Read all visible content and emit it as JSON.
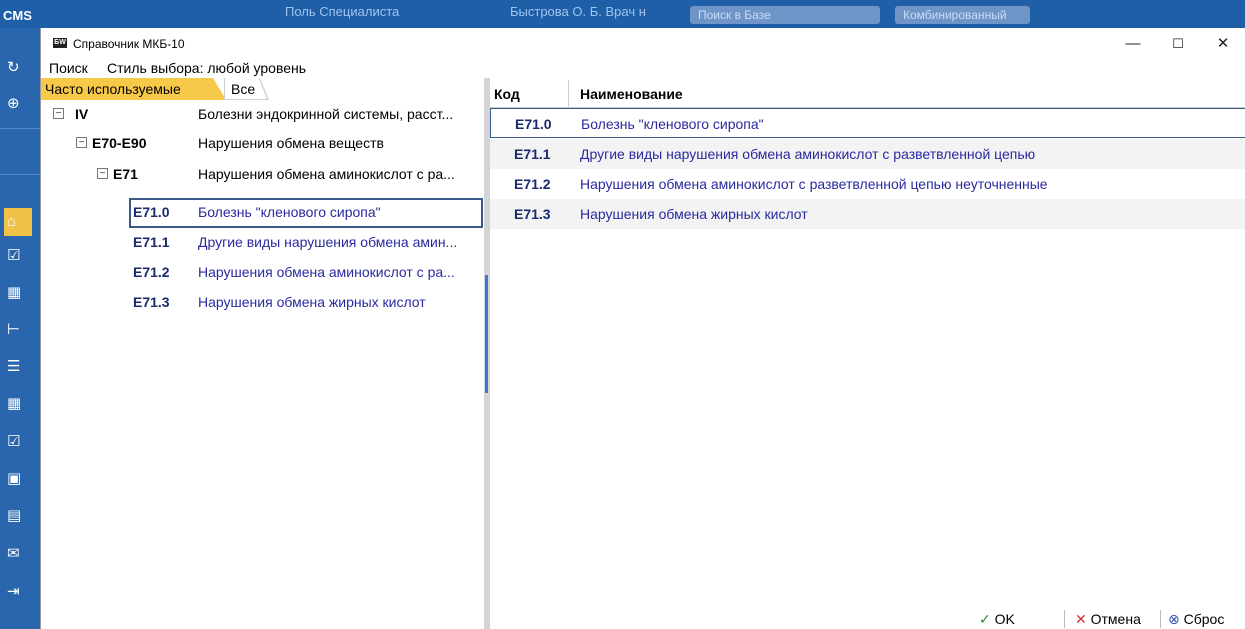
{
  "background_app": {
    "logo": "CMS",
    "top_items": [
      "Поль Специалиста",
      "Быстрова О. Б. Врач н",
      "Поиск в Базе",
      "Комбинированный"
    ]
  },
  "dialog": {
    "title": "Справочник МКБ-10",
    "app_icon_text": "БW",
    "window_controls": {
      "minimize": "—",
      "maximize": "☐",
      "close": "✕"
    },
    "toolbar": {
      "search": "Поиск",
      "style_label": "Стиль выбора: любой уровень"
    },
    "tabs": [
      {
        "label": "Часто используемые",
        "active": true
      },
      {
        "label": "Все",
        "active": false
      }
    ],
    "tree": [
      {
        "toggle": "−",
        "code": "IV",
        "name": "Болезни эндокринной системы, расст..."
      },
      {
        "toggle": "−",
        "code": "E70-E90",
        "name": "Нарушения обмена веществ"
      },
      {
        "toggle": "−",
        "code": "E71",
        "name": "Нарушения обмена аминокислот с ра..."
      },
      {
        "code": "E71.0",
        "name": "Болезнь \"кленового сиропа\"",
        "selected": true
      },
      {
        "code": "E71.1",
        "name": "Другие виды нарушения обмена амин..."
      },
      {
        "code": "E71.2",
        "name": "Нарушения обмена аминокислот с ра..."
      },
      {
        "code": "E71.3",
        "name": "Нарушения обмена жирных кислот"
      }
    ],
    "grid": {
      "col_code": "Код",
      "col_name": "Наименование",
      "rows": [
        {
          "code": "E71.0",
          "name": "Болезнь \"кленового сиропа\""
        },
        {
          "code": "E71.1",
          "name": "Другие виды нарушения обмена аминокислот с разветвленной цепью"
        },
        {
          "code": "E71.2",
          "name": "Нарушения обмена аминокислот с разветвленной цепью неуточненные"
        },
        {
          "code": "E71.3",
          "name": "Нарушения обмена жирных кислот"
        }
      ]
    },
    "footer": {
      "ok": "OK",
      "cancel": "Отмена",
      "reset": "Сброс"
    }
  },
  "colors": {
    "accent_tab": "#f7c948",
    "topbar": "#1f5fa8",
    "link_text": "#2a2aa0"
  }
}
